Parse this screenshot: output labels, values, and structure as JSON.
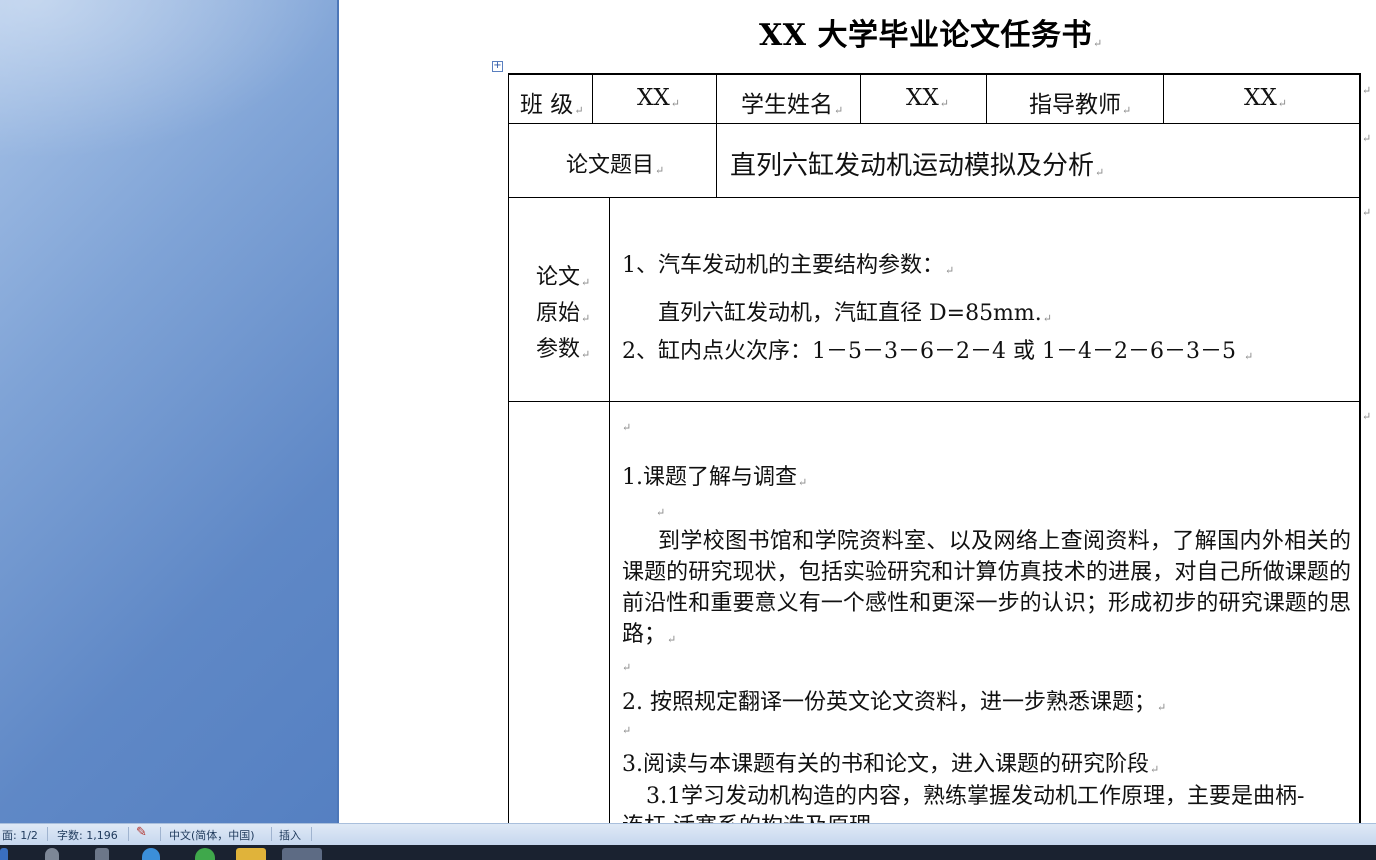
{
  "document": {
    "title": "XX 大学毕业论文任务书",
    "paragraph_mark": "↵",
    "header_row": {
      "class_label": "班 级",
      "class_value": "XX",
      "student_label": "学生姓名",
      "student_value": "XX",
      "advisor_label": "指导教师",
      "advisor_value": "XX"
    },
    "topic_row": {
      "label": "论文题目",
      "value": "直列六缸发动机运动模拟及分析"
    },
    "params_row": {
      "label_lines": [
        "论文",
        "原始",
        "参数"
      ],
      "line1": "1、汽车发动机的主要结构参数：",
      "line2": "直列六缸发动机，汽缸直径 D=85mm.",
      "line3": "2、缸内点火次序：1－5－3－6－2－4 或 1－4－2－6－3－5 "
    },
    "tasks_row": {
      "item1_title": "1.课题了解与调查",
      "item1_body": "到学校图书馆和学院资料室、以及网络上查阅资料，了解国内外相关的课题的研究现状，包括实验研究和计算仿真技术的进展，对自己所做课题的前沿性和重要意义有一个感性和更深一步的认识；形成初步的研究课题的思路；",
      "item2": "2. 按照规定翻译一份英文论文资料，进一步熟悉课题；",
      "item3": "3.阅读与本课题有关的书和论文，进入课题的研究阶段",
      "item3_1": "3.1学习发动机构造的内容，熟练掌握发动机工作原理，主要是曲柄-",
      "item3_1_cont": "连杆 活塞系的构造及原理"
    }
  },
  "status_bar": {
    "page": "面: 1/2",
    "word_count": "字数: 1,196",
    "language": "中文(简体，中国)",
    "mode": "插入"
  },
  "colors": {
    "side_pane": "#6f97d0",
    "status_bar": "#d3e1f3",
    "taskbar": "#1a2230"
  }
}
